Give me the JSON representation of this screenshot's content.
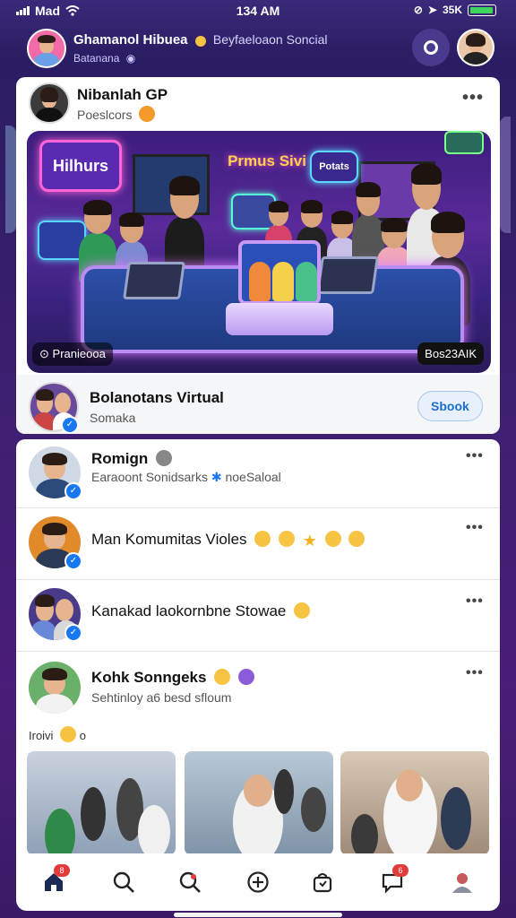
{
  "status_bar": {
    "carrier": "Mad",
    "time": "134 AM",
    "battery": "35K"
  },
  "header": {
    "title": "Ghamanol Hibuea",
    "tag": "Beyfaeloaon Soncial",
    "subtitle": "Batanana"
  },
  "post": {
    "author": "Nibanlah GP",
    "meta": "Poeslcors",
    "more": "•••",
    "hero_sign_left": "Hilhurs",
    "hero_sign_title": "Prmus Sivi",
    "hero_sign_right": "Potats",
    "hero_caption_left": "Pranieooa",
    "hero_caption_right": "Bos23AIK"
  },
  "suggestion": {
    "title": "Bolanotans Virtual",
    "subtitle": "Somaka",
    "button": "Sbook"
  },
  "feed": [
    {
      "title": "Romign",
      "subtitle": "Earaoont Sonidsarks",
      "subtitle2": "noeSaloal",
      "more": "•••"
    },
    {
      "title": "Man Komumitas Violes",
      "more": "•••"
    },
    {
      "title": "Kanakad laokornbne Stowae",
      "more": "•••"
    },
    {
      "title": "Kohk Sonngeks",
      "subtitle": "Sehtinloy a6 besd sfloum",
      "more": "•••"
    }
  ],
  "section_label": "Iroivi",
  "section_label_suffix": "o",
  "nav": {
    "home_badge": "8",
    "messages_badge": "6"
  },
  "colors": {
    "accent": "#1877f2",
    "badge": "#e23b3b",
    "bg": "#3a1a66"
  },
  "icons": [
    "home-icon",
    "search-icon",
    "explore-icon",
    "create-icon",
    "shop-icon",
    "messages-icon",
    "profile-icon"
  ]
}
